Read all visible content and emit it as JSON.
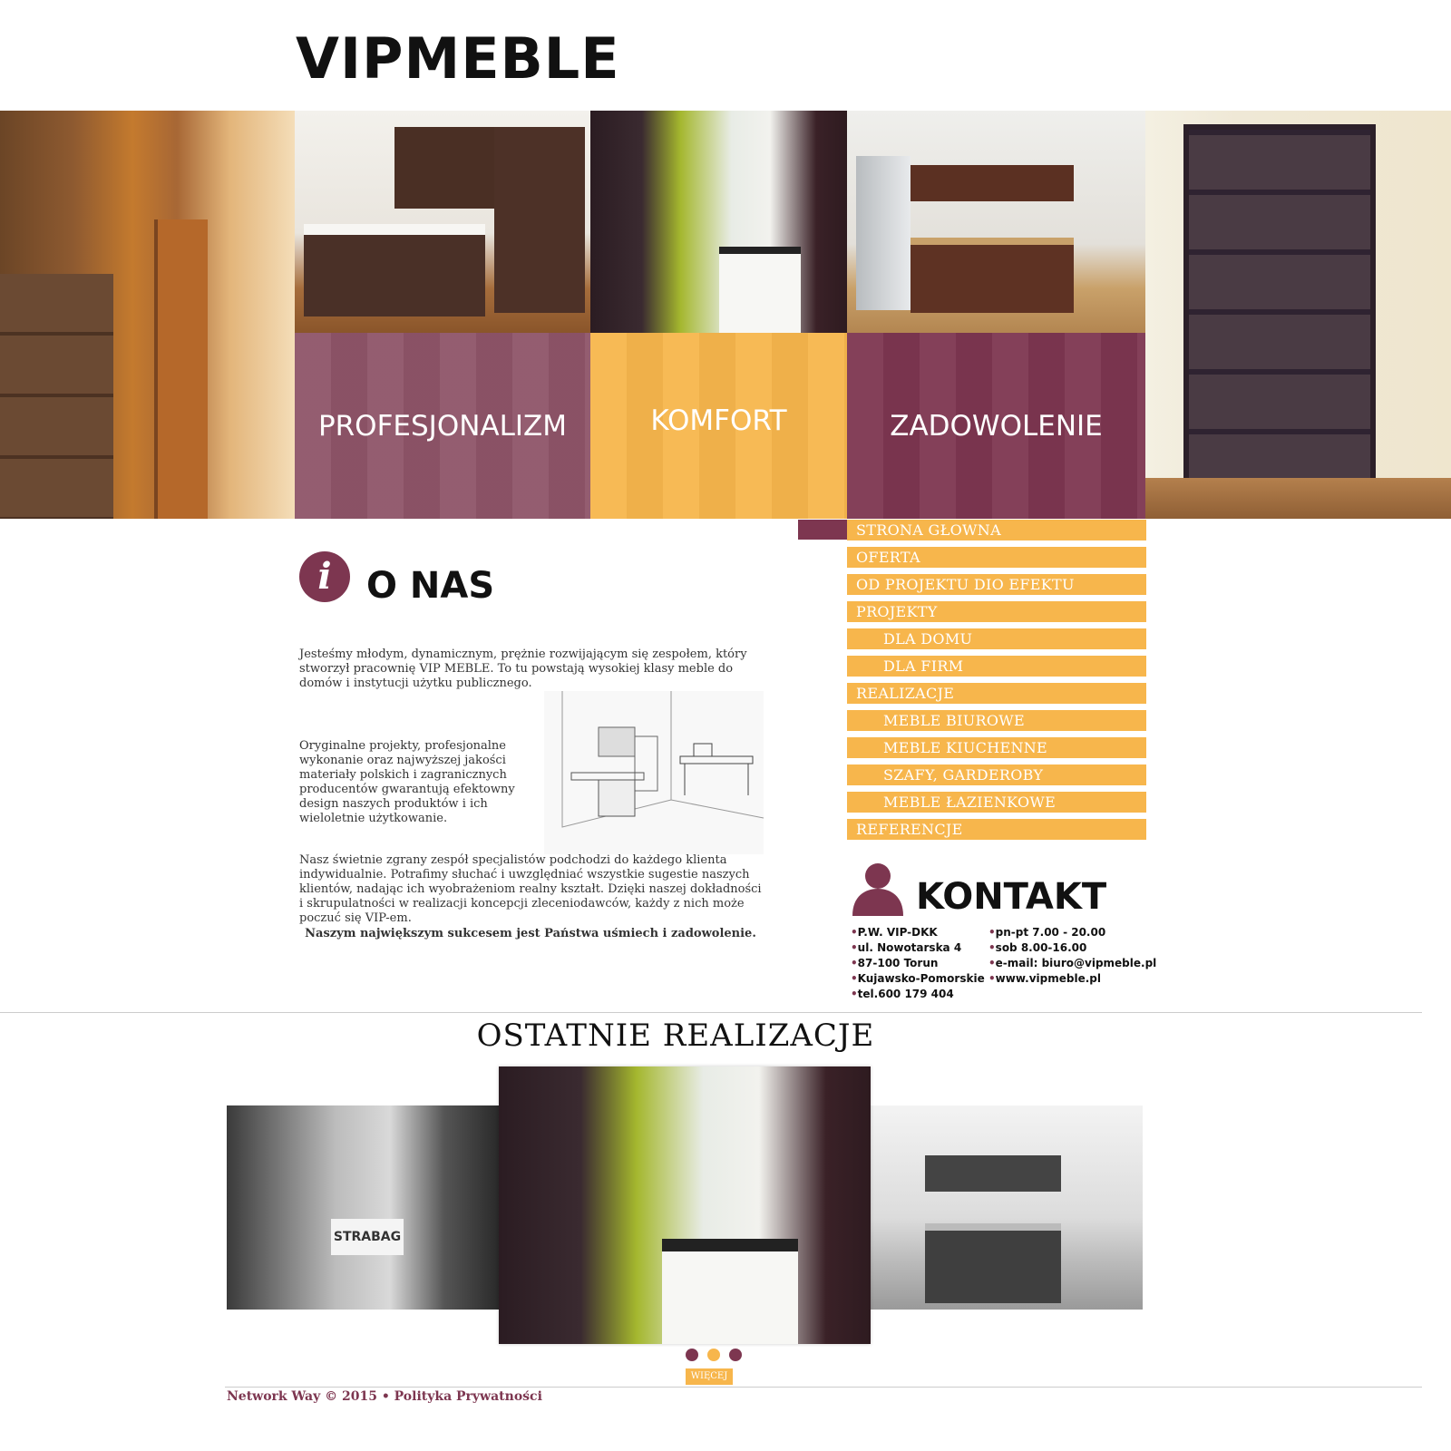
{
  "logo": "VIPMEBLE",
  "colors": {
    "accent_purple": "#7d3650",
    "accent_orange": "#f7b64c",
    "purple_light": "#8e5468"
  },
  "hero": {
    "panels": [
      "PROFESJONALIZM",
      "KOMFORT",
      "ZADOWOLENIE"
    ]
  },
  "nav": {
    "items": [
      {
        "label": "STRONA GŁOWNA"
      },
      {
        "label": "OFERTA"
      },
      {
        "label": "OD PROJEKTU DIO EFEKTU"
      },
      {
        "label": "PROJEKTY"
      },
      {
        "label": "DLA DOMU"
      },
      {
        "label": "DLA FIRM"
      },
      {
        "label": "REALIZACJE"
      },
      {
        "label": "MEBLE BIUROWE"
      },
      {
        "label": "MEBLE KIUCHENNE"
      },
      {
        "label": "SZAFY, GARDEROBY"
      },
      {
        "label": "MEBLE ŁAZIENKOWE"
      },
      {
        "label": "REFERENCJE"
      }
    ]
  },
  "about": {
    "icon": "info-icon",
    "icon_glyph": "i",
    "title": "O NAS",
    "p1": "Jesteśmy młodym, dynamicznym, prężnie rozwijającym się zespołem, który stworzył pracownię VIP MEBLE. To tu powstają wysokiej klasy meble do domów i instytucji użytku publicznego.",
    "p2": "Oryginalne projekty, profesjonalne wykonanie oraz najwyższej jakości materiały polskich i zagranicznych producentów gwarantują efektowny design naszych produktów i ich wieloletnie użytkowanie.",
    "p3": "Nasz świetnie zgrany zespół specjalistów podchodzi do każdego klienta indywidualnie. Potrafimy słuchać i uwzględniać wszystkie sugestie naszych klientów, nadając ich wyobrażeniom realny kształt. Dzięki naszej dokładności i skrupulatności w realizacji koncepcji zleceniodawców, każdy z nich może poczuć się VIP-em.",
    "p4": "Naszym największym sukcesem jest Państwa uśmiech i zadowolenie."
  },
  "contact": {
    "icon": "person-icon",
    "title": "KONTAKT",
    "col1": [
      "P.W. VIP-DKK",
      "ul. Nowotarska 4",
      "87-100 Torun",
      "Kujawsko-Pomorskie",
      "tel.600 179 404"
    ],
    "col2": [
      "pn-pt 7.00 - 20.00",
      "sob 8.00-16.00",
      "e-mail: biuro@vipmeble.pl",
      "www.vipmeble.pl"
    ]
  },
  "gallery": {
    "title": "OSTATNIE REALIZACJE",
    "left_sign": "STRABAG",
    "dots": [
      "#7d3650",
      "#f7b64c",
      "#7d3650"
    ],
    "more_label": "WIĘCEJ"
  },
  "footer": {
    "copyright": "Network Way © 2015",
    "separator": "•",
    "privacy": "Polityka Prywatności"
  }
}
